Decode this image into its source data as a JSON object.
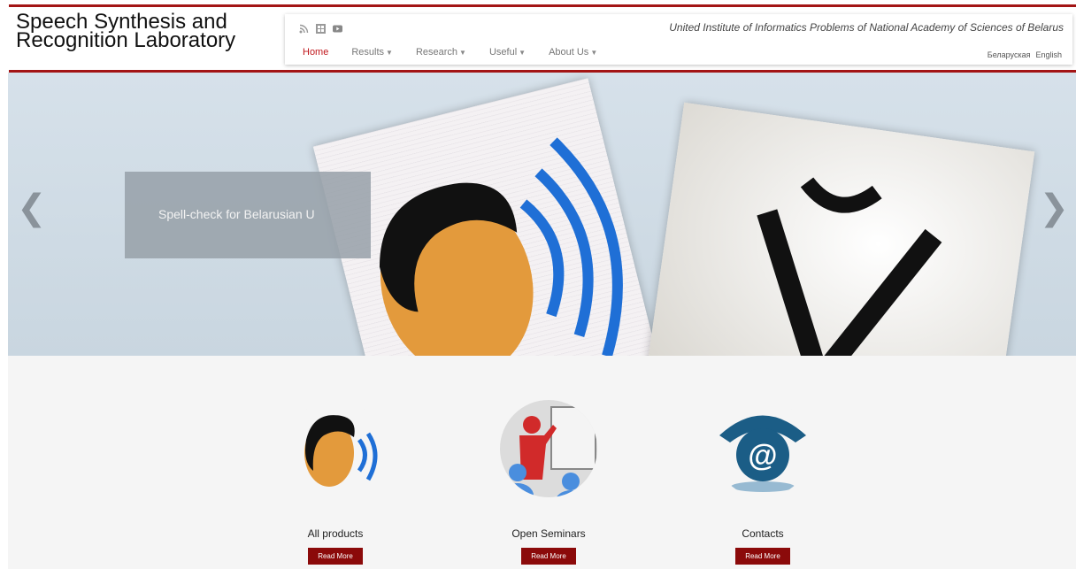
{
  "header": {
    "title_line1": "Speech Synthesis and",
    "title_line2": "Recognition Laboratory",
    "institute": "United Institute of Informatics Problems of National Academy of Sciences of Belarus",
    "social_icons": [
      "rss-icon",
      "vk-icon",
      "youtube-icon"
    ],
    "menu": [
      {
        "label": "Home",
        "active": true,
        "dropdown": false
      },
      {
        "label": "Results",
        "active": false,
        "dropdown": true
      },
      {
        "label": "Research",
        "active": false,
        "dropdown": true
      },
      {
        "label": "Useful",
        "active": false,
        "dropdown": true
      },
      {
        "label": "About Us",
        "active": false,
        "dropdown": true
      }
    ],
    "languages": [
      "Беларуская",
      "English"
    ],
    "accent_color": "#a31515"
  },
  "carousel": {
    "caption": "Spell-check for Belarusian U",
    "prev_icon": "chevron-left-icon",
    "next_icon": "chevron-right-icon"
  },
  "features": [
    {
      "label": "All products",
      "button": "Read More",
      "icon": "speaking-head-icon"
    },
    {
      "label": "Open Seminars",
      "button": "Read More",
      "icon": "presenter-icon"
    },
    {
      "label": "Contacts",
      "button": "Read More",
      "icon": "email-at-icon"
    }
  ]
}
